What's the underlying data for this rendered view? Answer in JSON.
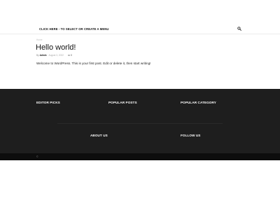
{
  "menu": {
    "link_label": "CLICK HERE - TO SELECT OR CREATE A MENU",
    "search_icon": "search-icon"
  },
  "breadcrumb": "Home",
  "post": {
    "title": "Hello world!",
    "by": "By",
    "author": "Admin",
    "date": "August 3, 2022",
    "comment_count": "0",
    "body": "Welcome to WordPress. This is your first post. Edit or delete it, then start writing!"
  },
  "footer": {
    "editor_picks": "EDITOR PICKS",
    "popular_posts": "POPULAR POSTS",
    "popular_category": "POPULAR CATEGORY",
    "about_us": "ABOUT US",
    "follow_us": "FOLLOW US"
  },
  "subfooter": {
    "copyright": "©"
  },
  "colors": {
    "footer_bg": "#1e1e1e",
    "subfooter_bg": "#0d0d0d",
    "text": "#111111"
  }
}
